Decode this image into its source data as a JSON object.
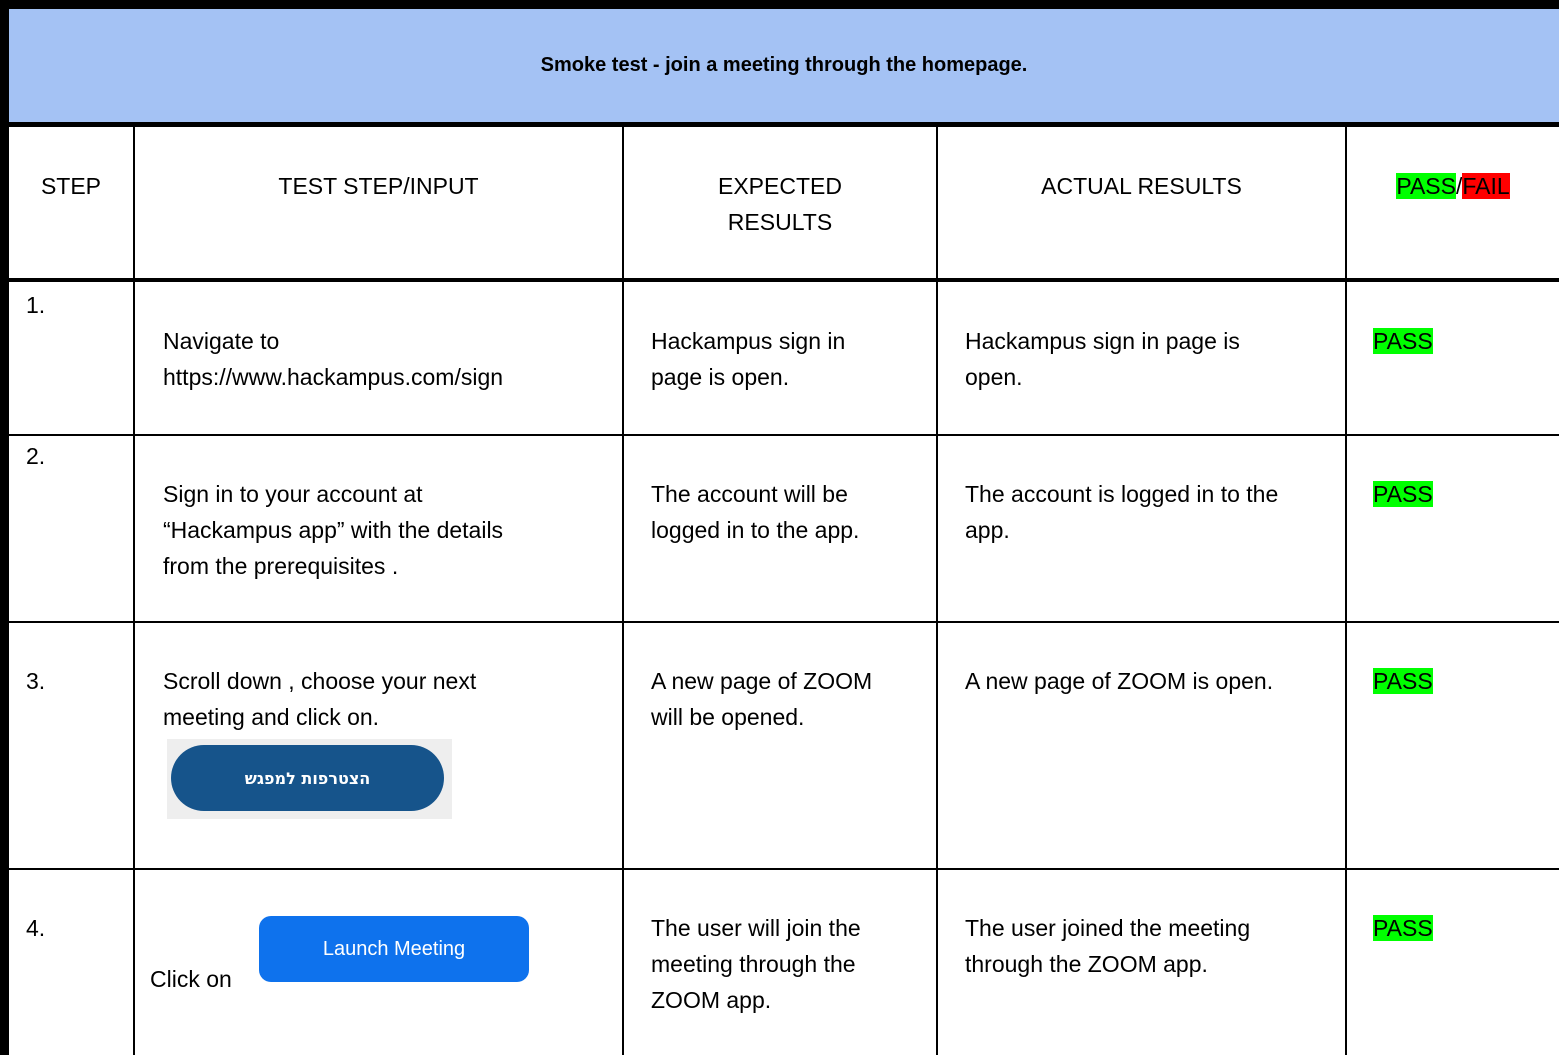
{
  "title": "Smoke test - join a meeting through the homepage.",
  "headers": {
    "step": "STEP",
    "input": "TEST STEP/INPUT",
    "expected_line1": "EXPECTED",
    "expected_line2": "RESULTS",
    "actual": "ACTUAL RESULTS",
    "pass": "PASS",
    "slash": "/",
    "fail": "FAIL"
  },
  "rows": [
    {
      "step": "1.",
      "input": [
        "Navigate to",
        "https://www.hackampus.com/sign"
      ],
      "expected": [
        "Hackampus sign in",
        "page is open."
      ],
      "actual": [
        "Hackampus sign in page is",
        "open."
      ],
      "result": "PASS"
    },
    {
      "step": "2.",
      "input": [
        "Sign in to your account at",
        "“Hackampus app” with the details",
        "from the prerequisites ."
      ],
      "expected": [
        "The account will be",
        "logged in to the app."
      ],
      "actual": [
        "The account is logged in to the",
        "app."
      ],
      "result": "PASS"
    },
    {
      "step": "3.",
      "input": [
        "Scroll down , choose your next",
        "meeting and click on."
      ],
      "join_button": "הצטרפות למפגש",
      "expected": [
        "A new page of ZOOM",
        "will be opened."
      ],
      "actual": [
        "A new page of ZOOM is open."
      ],
      "result": "PASS"
    },
    {
      "step": "4.",
      "input_prefix": "Click on",
      "launch_button": "Launch Meeting",
      "expected": [
        "The user will join the",
        "meeting through the",
        "ZOOM app."
      ],
      "actual": [
        "The user joined the meeting",
        "through the ZOOM app."
      ],
      "result": "PASS"
    }
  ],
  "colors": {
    "title_bg": "#a4c2f4",
    "pass_highlight": "#00ff00",
    "fail_highlight": "#ff0000",
    "join_button_bg": "#16548b",
    "launch_button_bg": "#0e72ed"
  }
}
